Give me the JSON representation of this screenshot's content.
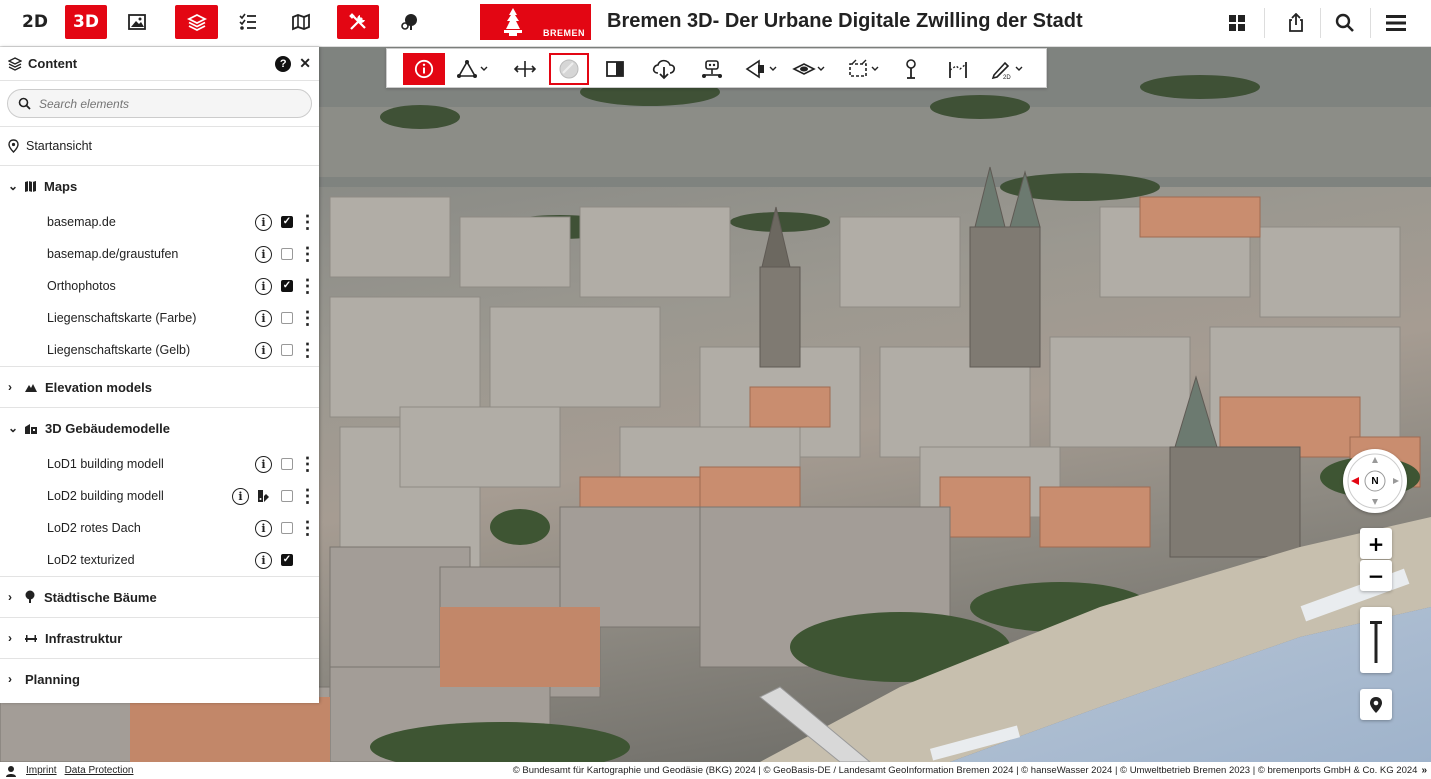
{
  "header": {
    "btn_2d": "2D",
    "btn_3d": "3D",
    "logo_text": "BREMEN",
    "title": "Bremen 3D- Der Urbane Digitale Zwilling der Stadt",
    "accent": "#e30613"
  },
  "panel": {
    "title": "Content",
    "help": "?",
    "close": "✕",
    "search_placeholder": "Search elements",
    "start_view": "Startansicht",
    "sections": {
      "maps": "Maps",
      "elevation": "Elevation models",
      "buildings": "3D Gebäudemodelle",
      "trees": "Städtische Bäume",
      "infra": "Infrastruktur",
      "planning": "Planning"
    },
    "maps_items": [
      "basemap.de",
      "basemap.de/graustufen",
      "Orthophotos",
      "Liegenschaftskarte (Farbe)",
      "Liegenschaftskarte (Gelb)"
    ],
    "building_items": [
      "LoD1 building modell",
      "LoD2 building modell",
      "LoD2 rotes Dach",
      "LoD2 texturized"
    ],
    "info_glyph": "i",
    "check_glyph": "✓",
    "more_glyph": "⋮"
  },
  "map": {
    "compass_label": "N",
    "zoom_in": "+",
    "zoom_out": "−"
  },
  "footer": {
    "imprint": "Imprint",
    "data_protection": "Data Protection",
    "attribution": "© Bundesamt für Kartographie und Geodäsie (BKG) 2024 | © GeoBasis-DE / Landesamt GeoInformation Bremen 2024 | © hanseWasser 2024 | © Umweltbetrieb Bremen 2023 | © bremenports GmbH & Co. KG 2024",
    "more": "»"
  }
}
